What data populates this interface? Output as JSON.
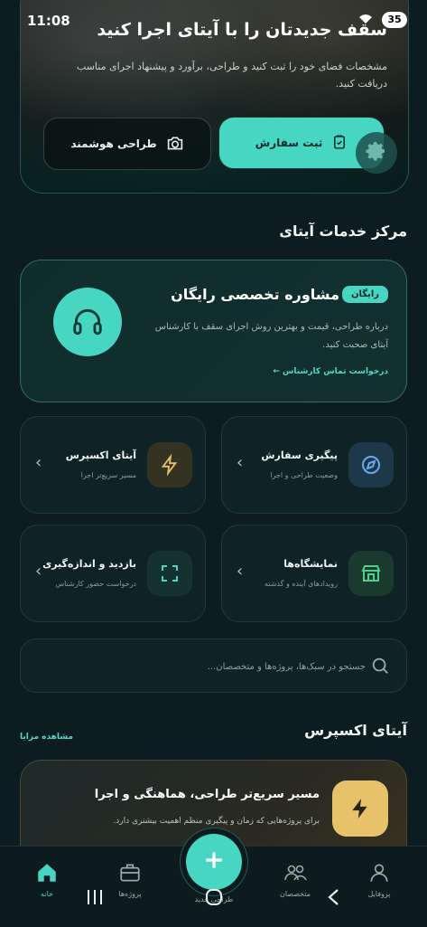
{
  "status_bar": {
    "time": "11:08",
    "battery": "35"
  },
  "hero": {
    "title": "سقف جدیدتان را با آیتای اجرا کنید",
    "description": "مشخصات فضای خود را ثبت کنید و طراحی، برآورد و پیشنهاد اجرای مناسب دریافت کنید.",
    "order_button": "ثبت سفارش",
    "smart_design_button": "طراحی هوشمند"
  },
  "services": {
    "section_title": "مرکز خدمات آیتای",
    "consult": {
      "badge": "رایگان",
      "title": "مشاوره تخصصی رایگان",
      "description": "درباره طراحی، قیمت و بهترین روش اجرای سقف با کارشناس آیتای صحبت کنید.",
      "link": "درخواست تماس کارشناس ←"
    },
    "cards": [
      {
        "title": "پیگیری سفارش",
        "subtitle": "وضعیت طراحی و اجرا",
        "icon": "navigation-icon"
      },
      {
        "title": "آیتای اکسپرس",
        "subtitle": "مسیر سریع‌تر اجرا",
        "icon": "lightning-icon"
      },
      {
        "title": "نمایشگاه‌ها",
        "subtitle": "رویدادهای آینده و گذشته",
        "icon": "store-icon"
      },
      {
        "title": "بازدید و اندازه‌گیری",
        "subtitle": "درخواست حضور کارشناس",
        "icon": "scan-icon"
      }
    ]
  },
  "search": {
    "placeholder": "جستجو در سبک‌ها، پروژه‌ها و متخصصان..."
  },
  "express": {
    "section_title": "آیتای اکسپرس",
    "see_all": "مشاهده مزایا",
    "title": "مسیر سریع‌تر طراحی، هماهنگی و اجرا",
    "subtitle": "برای پروژه‌هایی که زمان و پیگیری منظم اهمیت بیشتری دارد."
  },
  "bottom_nav": {
    "items": [
      {
        "label": "پروفایل",
        "icon": "user-icon"
      },
      {
        "label": "متخصصان",
        "icon": "people-icon"
      },
      {
        "label": "طراحی جدید",
        "icon": "plus-icon"
      },
      {
        "label": "پروژه‌ها",
        "icon": "briefcase-icon"
      },
      {
        "label": "خانه",
        "icon": "home-icon"
      }
    ]
  },
  "colors": {
    "accent": "#46d6c2",
    "background": "#0c1c20",
    "card": "#0f2226",
    "gold": "#e8c26a"
  }
}
